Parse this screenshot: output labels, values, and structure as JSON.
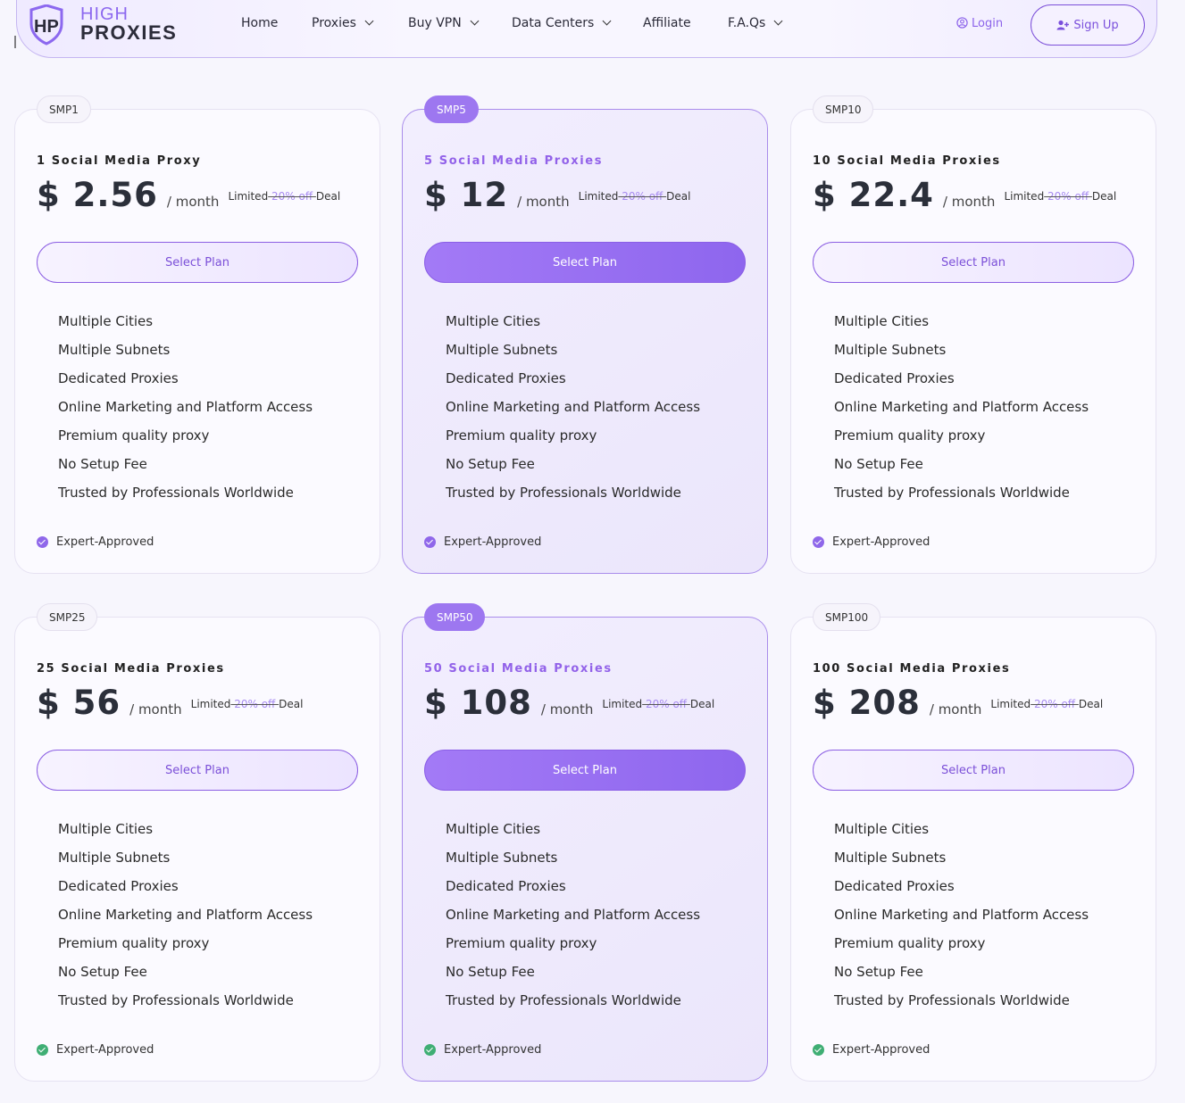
{
  "brand": {
    "line1": "HIGH",
    "line2": "PROXIES",
    "mark": "HP"
  },
  "nav": [
    {
      "label": "Home",
      "dropdown": false
    },
    {
      "label": "Proxies",
      "dropdown": true
    },
    {
      "label": "Buy VPN",
      "dropdown": true
    },
    {
      "label": "Data Centers",
      "dropdown": true
    },
    {
      "label": "Affiliate",
      "dropdown": false
    },
    {
      "label": "F.A.Qs",
      "dropdown": true
    }
  ],
  "auth": {
    "login": "Login",
    "signup": "Sign Up"
  },
  "colors": {
    "accent": "#8c63ea",
    "featured_bg": "#ebe6fb",
    "check_purple": "#8f67ea",
    "check_green": "#3fae74"
  },
  "plans": [
    {
      "code": "SMP1",
      "title": "1 Social Media Proxy",
      "price": "$ 2.56",
      "period": "/ month",
      "featured": false
    },
    {
      "code": "SMP5",
      "title": "5 Social Media Proxies",
      "price": "$ 12",
      "period": "/ month",
      "featured": true
    },
    {
      "code": "SMP10",
      "title": "10 Social Media Proxies",
      "price": "$ 22.4",
      "period": "/ month",
      "featured": false
    },
    {
      "code": "SMP25",
      "title": "25 Social Media Proxies",
      "price": "$ 56",
      "period": "/ month",
      "featured": false
    },
    {
      "code": "SMP50",
      "title": "50 Social Media Proxies",
      "price": "$ 108",
      "period": "/ month",
      "featured": true
    },
    {
      "code": "SMP100",
      "title": "100 Social Media Proxies",
      "price": "$ 208",
      "period": "/ month",
      "featured": false
    }
  ],
  "deal": {
    "prefix": "Limited",
    "strike": "20% off",
    "suffix": "Deal"
  },
  "select_label": "Select Plan",
  "features": [
    "Multiple Cities",
    "Multiple Subnets",
    "Dedicated Proxies",
    "Online Marketing and Platform Access",
    "Premium quality proxy",
    "No Setup Fee",
    "Trusted by Professionals Worldwide"
  ],
  "approved_label": "Expert-Approved"
}
